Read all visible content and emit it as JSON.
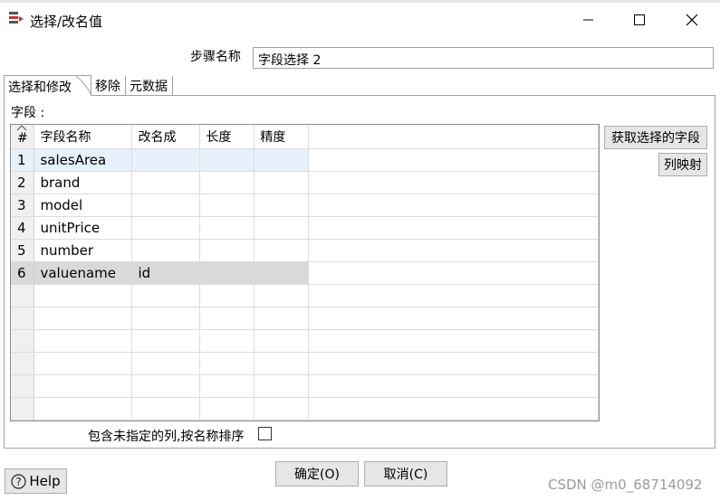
{
  "window": {
    "title": "选择/改名值",
    "minimize_label": "—",
    "maximize_label": "☐",
    "close_label": "✕"
  },
  "step": {
    "label": "步骤名称",
    "value": "字段选择 2"
  },
  "tabs": [
    {
      "label": "选择和修改",
      "active": true
    },
    {
      "label": "移除",
      "active": false
    },
    {
      "label": "元数据",
      "active": false
    }
  ],
  "fields": {
    "label": "字段 :",
    "columns": [
      "#",
      "字段名称",
      "改名成",
      "长度",
      "精度"
    ],
    "rows": [
      {
        "num": "1",
        "name": "salesArea",
        "rename": "",
        "length": "",
        "precision": ""
      },
      {
        "num": "2",
        "name": "brand",
        "rename": "",
        "length": "",
        "precision": ""
      },
      {
        "num": "3",
        "name": "model",
        "rename": "",
        "length": "",
        "precision": ""
      },
      {
        "num": "4",
        "name": "unitPrice",
        "rename": "",
        "length": "",
        "precision": ""
      },
      {
        "num": "5",
        "name": "number",
        "rename": "",
        "length": "",
        "precision": ""
      },
      {
        "num": "6",
        "name": "valuename",
        "rename": "id",
        "length": "",
        "precision": ""
      }
    ],
    "get_fields_button": "获取选择的字段",
    "column_mapping_button": "列映射"
  },
  "include_unspecified": {
    "label": "包含未指定的列,按名称排序",
    "checked": false
  },
  "footer": {
    "help_label": "Help",
    "ok_label": "确定(O)",
    "cancel_label": "取消(C)"
  },
  "watermark": "CSDN @m0_68714092",
  "colors": {
    "row_highlight": "#e6f1fb",
    "row_selected": "#d9d9d9",
    "button_bg": "#e6e6e6"
  }
}
